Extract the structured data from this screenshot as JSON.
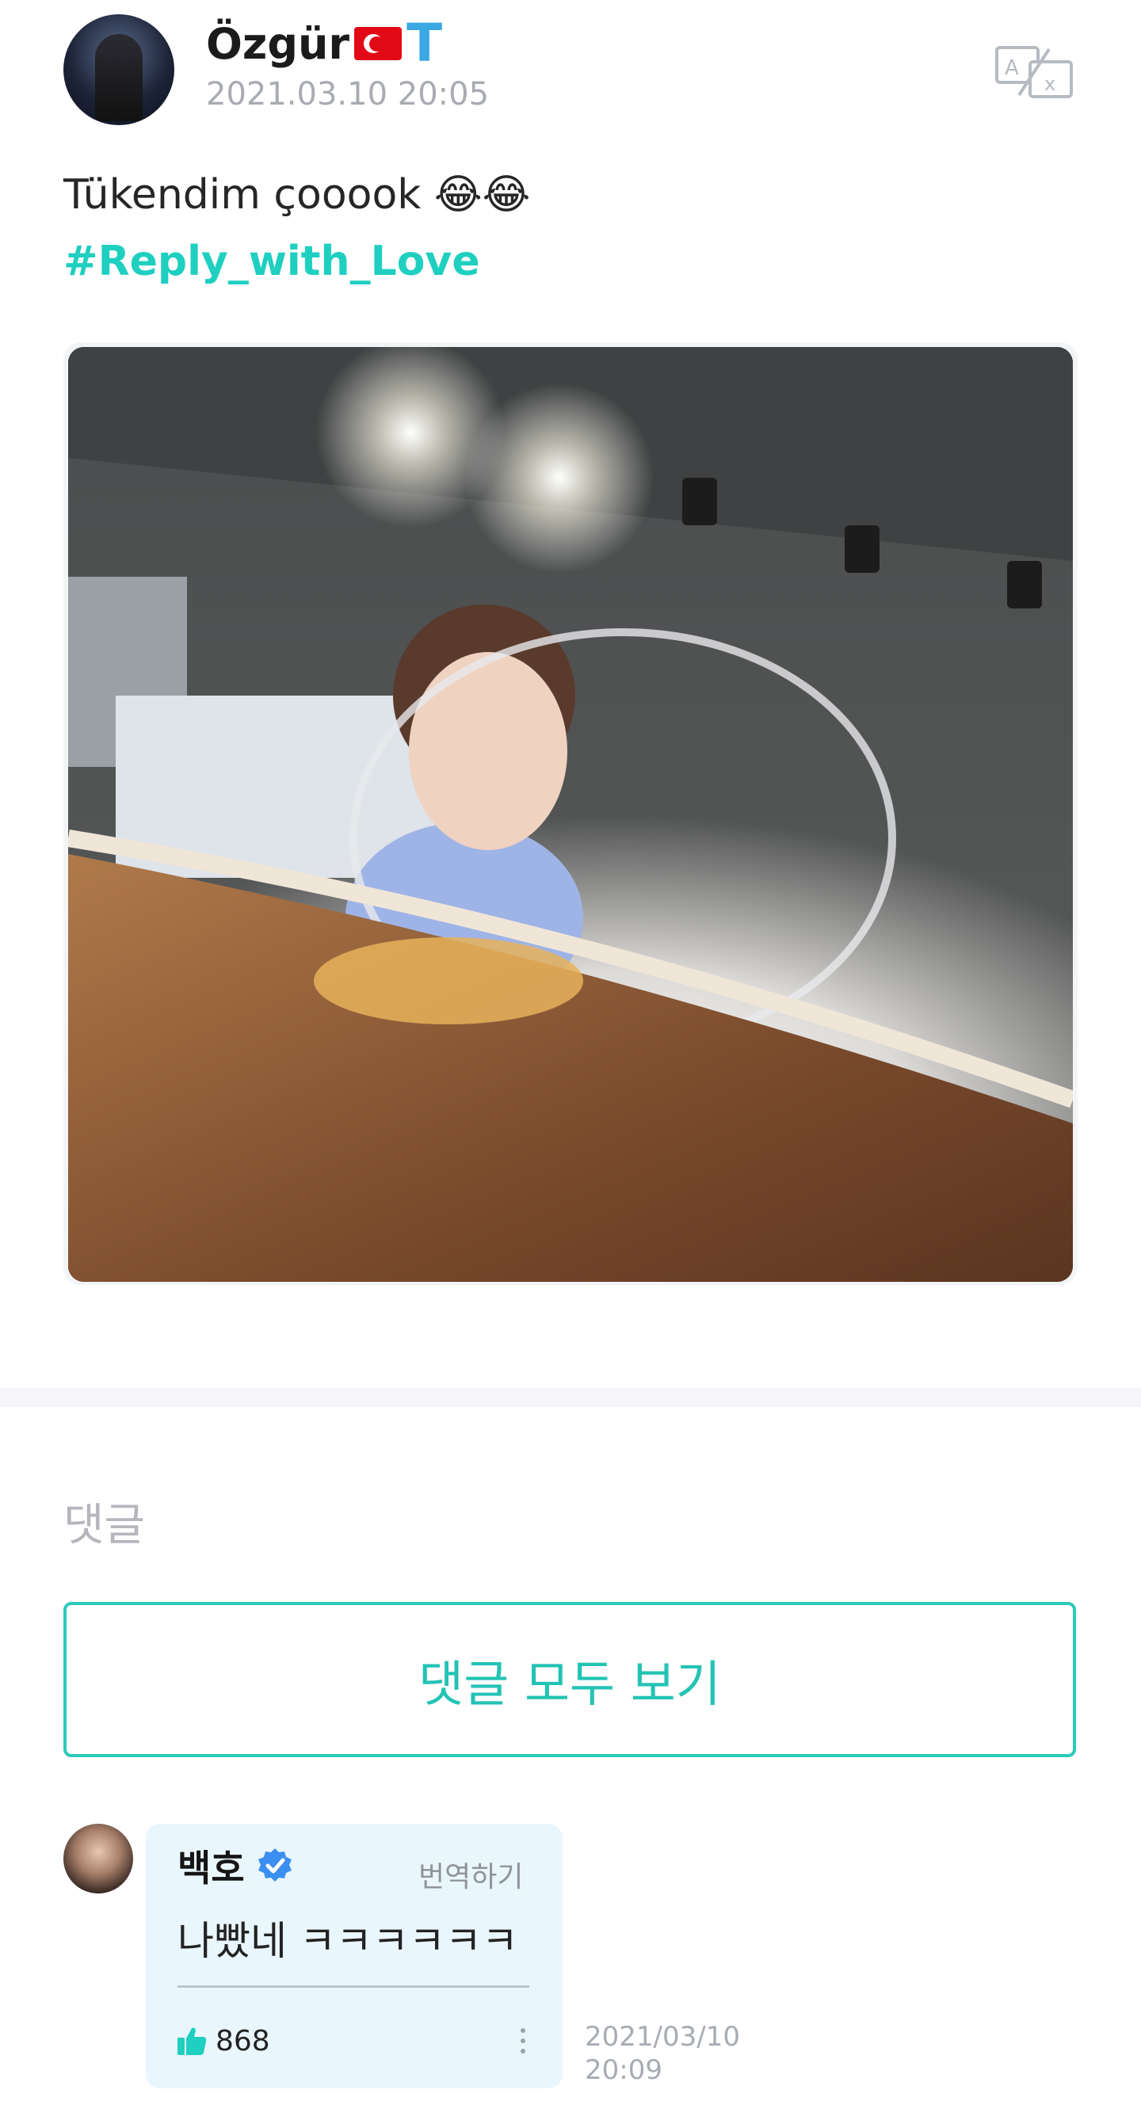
{
  "post": {
    "author": "Özgür",
    "badge_letter": "T",
    "timestamp": "2021.03.10 20:05",
    "text": "Tükendim çooook 😂😂",
    "hashtag": "#Reply_with_Love"
  },
  "comments": {
    "section_label": "댓글",
    "view_all_label": "댓글 모두 보기",
    "items": [
      {
        "author": "백호",
        "translate_label": "번역하기",
        "text": "나빴네 ㅋㅋㅋㅋㅋㅋ",
        "likes": "868",
        "time_date": "2021/03/10",
        "time_clock": "20:09"
      }
    ]
  },
  "colors": {
    "accent": "#23c3b4",
    "hashtag": "#1fcfc0",
    "verified": "#3b8ff0",
    "bubble_bg": "#eaf6fd"
  },
  "icons": [
    "translate-icon",
    "flag-turkey-icon",
    "verified-icon",
    "thumbs-up-icon",
    "more-options-icon"
  ]
}
